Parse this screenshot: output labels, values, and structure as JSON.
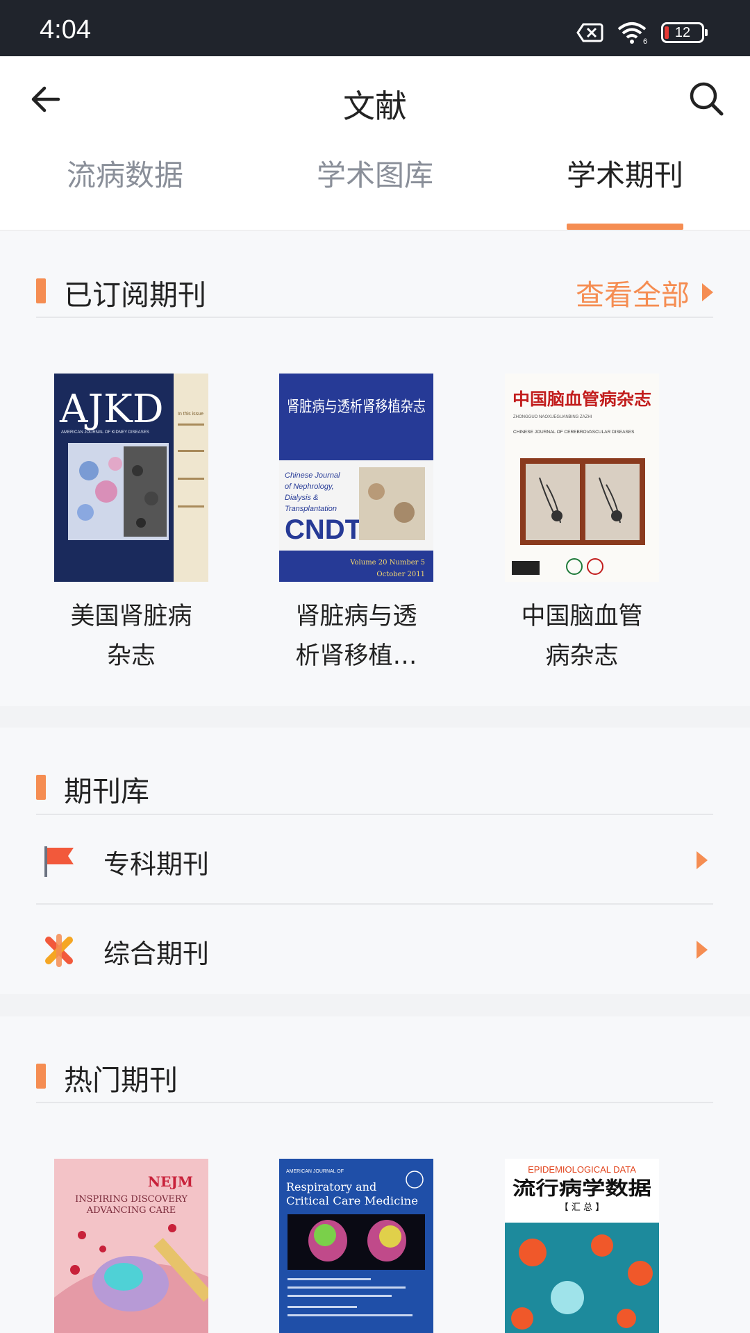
{
  "status_bar": {
    "time": "4:04",
    "battery": "12"
  },
  "header": {
    "title": "文献"
  },
  "tabs": [
    {
      "label": "流病数据",
      "active": false
    },
    {
      "label": "学术图库",
      "active": false
    },
    {
      "label": "学术期刊",
      "active": true
    }
  ],
  "colors": {
    "accent": "#f58d52",
    "status_bar": "#20242c"
  },
  "subscribed": {
    "title": "已订阅期刊",
    "view_all": "查看全部",
    "journals": [
      {
        "name": "美国肾脏病杂志",
        "cover": "AJKD"
      },
      {
        "name": "肾脏病与透析肾移植杂志",
        "cover": "CNDT"
      },
      {
        "name": "中国脑血管病杂志",
        "cover": "中国脑血管病杂志"
      }
    ]
  },
  "library": {
    "title": "期刊库",
    "items": [
      {
        "label": "专科期刊",
        "icon": "flag-icon"
      },
      {
        "label": "综合期刊",
        "icon": "asterisk-icon"
      }
    ]
  },
  "hot": {
    "title": "热门期刊",
    "journals": [
      {
        "cover": "NEJM"
      },
      {
        "cover": "Respiratory and Critical Care Medicine"
      },
      {
        "cover": "流行病学数据"
      }
    ]
  },
  "covers": {
    "ajkd": {
      "logo": "AJKD",
      "sub": "AMERICAN JOURNAL OF KIDNEY DISEASES",
      "side": "In this issue"
    },
    "cndt": {
      "cn_title": "肾脏病与透析肾移植杂志",
      "en_lines": [
        "Chinese Journal",
        "of Nephrology,",
        "Dialysis &",
        "Transplantation"
      ],
      "logo": "CNDT",
      "vol": "Volume 20 Number 5",
      "date": "October 2011"
    },
    "cbd": {
      "cn_title": "中国脑血管病杂志",
      "pinyin": "ZHONGGUO NAOXUEGUANBING ZAZHI",
      "en": "CHINESE JOURNAL OF CEREBROVASCULAR DISEASES"
    },
    "nejm": {
      "logo": "NEJM",
      "line1": "INSPIRING DISCOVERY",
      "line2": "ADVANCING CARE"
    },
    "rccm": {
      "top": "AMERICAN JOURNAL OF",
      "line1": "Respiratory and",
      "line2": "Critical Care Medicine"
    },
    "epi": {
      "en": "EPIDEMIOLOGICAL DATA",
      "cn": "流行病学数据",
      "sub": "【 汇 总 】"
    }
  }
}
